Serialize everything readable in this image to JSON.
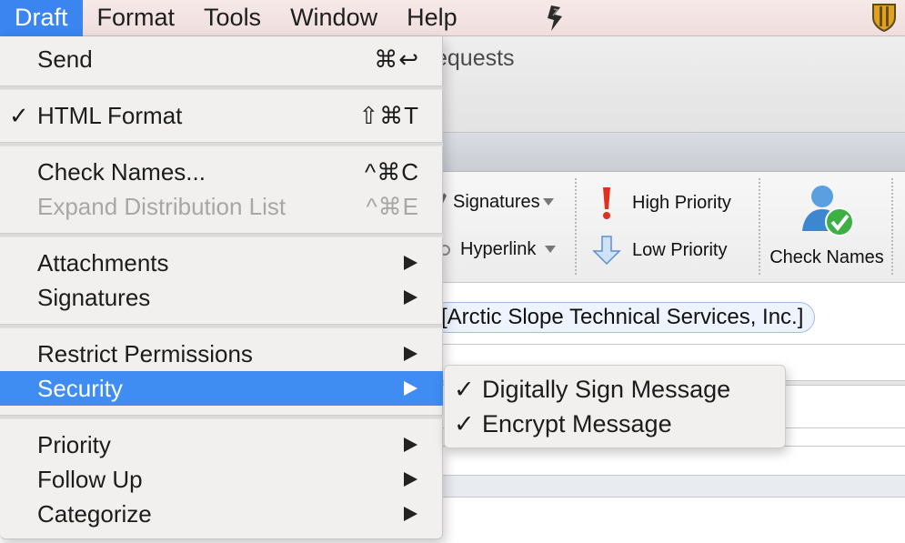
{
  "menubar": {
    "items": [
      {
        "label": "Draft",
        "active": true
      },
      {
        "label": "Format",
        "active": false
      },
      {
        "label": "Tools",
        "active": false
      },
      {
        "label": "Window",
        "active": false
      },
      {
        "label": "Help",
        "active": false
      }
    ],
    "icons": [
      "script-icon",
      "shield-icon"
    ],
    "active_color": "#3a85f0"
  },
  "window": {
    "title_fragment": "equests"
  },
  "ribbon": {
    "signatures_label": "Signatures",
    "hyperlink_label": "Hyperlink",
    "high_priority_label": "High Priority",
    "low_priority_label": "Low Priority",
    "check_names_label": "Check Names"
  },
  "recipient": {
    "text": "[Arctic Slope Technical Services, Inc.]"
  },
  "draft_menu": {
    "send": {
      "label": "Send",
      "shortcut": "⌘↩"
    },
    "html_format": {
      "label": "HTML Format",
      "checked": true,
      "check": "✓",
      "shortcut": "⇧⌘T"
    },
    "check_names": {
      "label": "Check Names...",
      "shortcut": "^⌘C"
    },
    "expand_distribution_list": {
      "label": "Expand Distribution List",
      "shortcut": "^⌘E",
      "disabled": true
    },
    "attachments": {
      "label": "Attachments"
    },
    "signatures": {
      "label": "Signatures"
    },
    "restrict_permissions": {
      "label": "Restrict Permissions"
    },
    "security": {
      "label": "Security",
      "highlighted": true
    },
    "priority": {
      "label": "Priority"
    },
    "follow_up": {
      "label": "Follow Up"
    },
    "categorize": {
      "label": "Categorize"
    },
    "highlight_color": "#3f8df3"
  },
  "security_submenu": {
    "items": [
      {
        "label": "Digitally Sign Message",
        "checked": true,
        "check": "✓"
      },
      {
        "label": "Encrypt Message",
        "checked": true,
        "check": "✓"
      }
    ]
  }
}
